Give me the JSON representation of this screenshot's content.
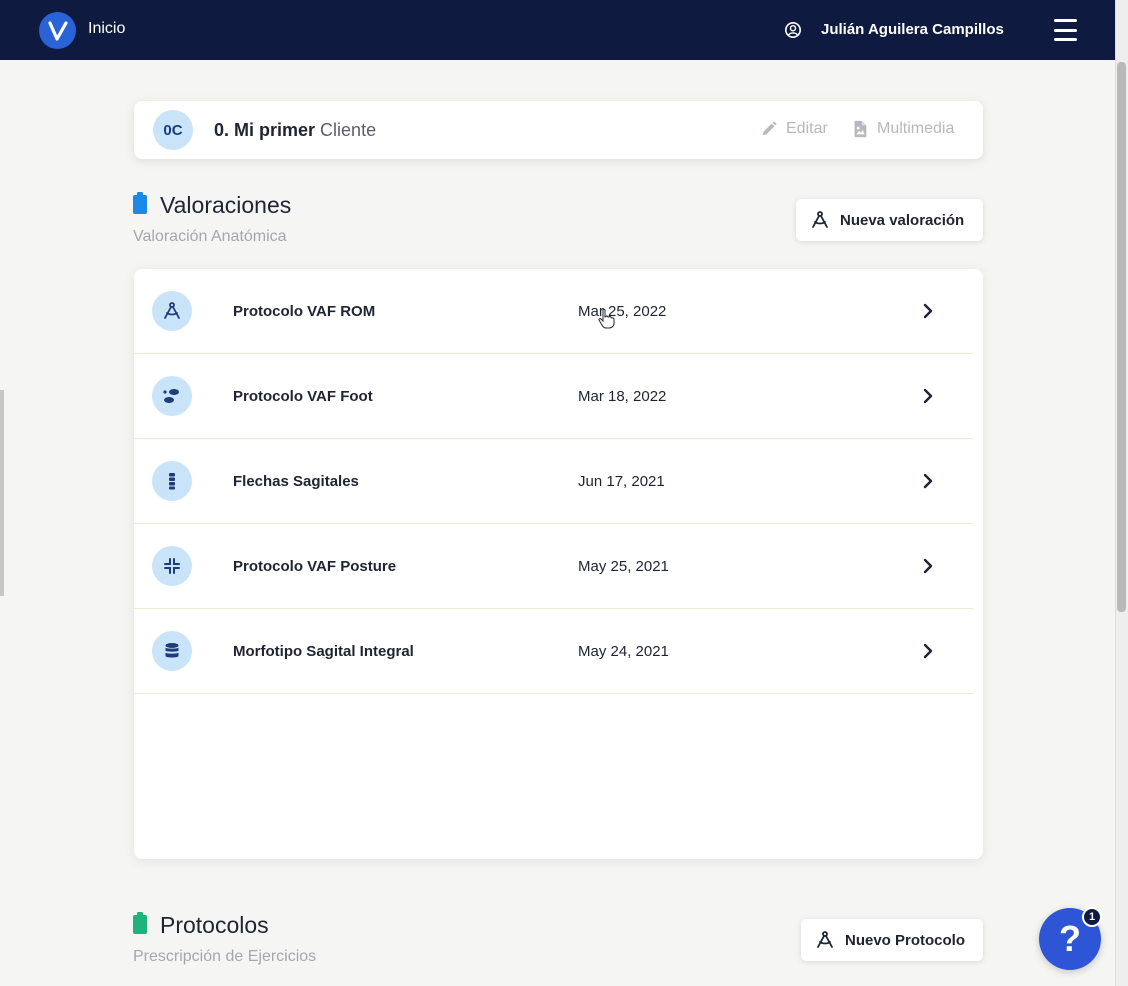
{
  "header": {
    "home_label": "Inicio",
    "user_name": "Julián Aguilera Campillos",
    "icons": [
      "logo",
      "user-circle-icon",
      "hamburger-menu-icon"
    ]
  },
  "client": {
    "initials": "0C",
    "name_bold": "0. Mi primer",
    "name_light": "Cliente",
    "edit_label": "Editar",
    "media_label": "Multimedia"
  },
  "valoraciones": {
    "title": "Valoraciones",
    "subtitle": "Valoración Anatómica",
    "new_button_label": "Nueva valoración",
    "icon_color": "#1e88e5",
    "items": [
      {
        "icon": "compass-icon",
        "name": "Protocolo VAF ROM",
        "date": "Mar 25, 2022"
      },
      {
        "icon": "footprints-icon",
        "name": "Protocolo VAF Foot",
        "date": "Mar 18, 2022"
      },
      {
        "icon": "spine-icon",
        "name": "Flechas Sagitales",
        "date": "Jun 17, 2021"
      },
      {
        "icon": "compress-icon",
        "name": "Protocolo VAF Posture",
        "date": "May 25, 2021"
      },
      {
        "icon": "database-icon",
        "name": "Morfotipo Sagital Integral",
        "date": "May 24, 2021"
      }
    ]
  },
  "protocolos": {
    "title": "Protocolos",
    "subtitle": "Prescripción de Ejercicios",
    "new_button_label": "Nuevo Protocolo",
    "icon_color": "#1db37a"
  },
  "help": {
    "label": "?",
    "badge_count": "1"
  }
}
